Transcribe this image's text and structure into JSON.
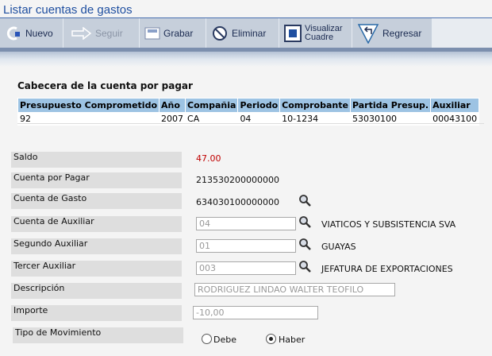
{
  "window": {
    "title": "Listar cuentas de gastos"
  },
  "toolbar": {
    "nuevo": "Nuevo",
    "seguir": "Seguir",
    "grabar": "Grabar",
    "eliminar": "Eliminar",
    "visualizar_line1": "Visualizar",
    "visualizar_line2": "Cuadre",
    "regresar": "Regresar"
  },
  "header": {
    "title": "Cabecera de la cuenta por pagar",
    "columns": [
      "Presupuesto Comprometido",
      "Año",
      "Compañia",
      "Periodo",
      "Comprobante",
      "Partida Presup.",
      "Auxiliar"
    ],
    "row": [
      "92",
      "2007",
      "CA",
      "04",
      "10-1234",
      "53030100",
      "00043100"
    ]
  },
  "form": {
    "saldo": {
      "label": "Saldo",
      "value": "47.00"
    },
    "cuenta_pagar": {
      "label": "Cuenta por Pagar",
      "value": "213530200000000"
    },
    "cuenta_gasto": {
      "label": "Cuenta de Gasto",
      "value": "634030100000000"
    },
    "cuenta_auxiliar": {
      "label": "Cuenta de Auxiliar",
      "value": "04",
      "description": "VIATICOS Y SUBSISTENCIA SVA"
    },
    "segundo_auxiliar": {
      "label": "Segundo Auxiliar",
      "value": "01",
      "description": "GUAYAS"
    },
    "tercer_auxiliar": {
      "label": "Tercer Auxiliar",
      "value": "003",
      "description": "JEFATURA DE EXPORTACIONES"
    },
    "descripcion": {
      "label": "Descripción",
      "value": "RODRIGUEZ LINDAO WALTER TEOFILO"
    },
    "importe": {
      "label": "Importe",
      "value": "-10,00"
    },
    "tipo_movimiento": {
      "label": "Tipo de Movimiento",
      "option_debe": "Debe",
      "option_haber": "Haber",
      "selected": "Haber"
    }
  },
  "colors": {
    "saldo_value": "#c00000",
    "table_header": "#9dc3e3",
    "title": "#1f4fa0"
  }
}
